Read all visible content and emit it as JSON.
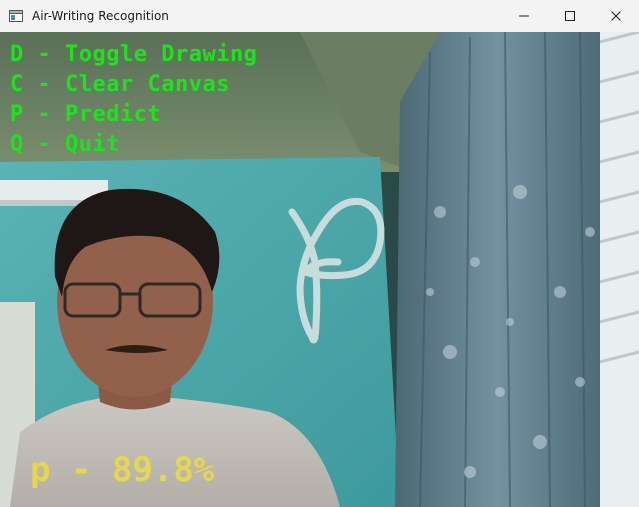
{
  "window": {
    "title": "Air-Writing Recognition",
    "icon": "app-window-icon",
    "controls": [
      "minimize-icon",
      "maximize-icon",
      "close-icon"
    ]
  },
  "overlay": {
    "instructions": [
      {
        "key": "D",
        "sep": " - ",
        "label": "Toggle Drawing"
      },
      {
        "key": "C",
        "sep": " - ",
        "label": "Clear Canvas"
      },
      {
        "key": "P",
        "sep": " - ",
        "label": "Predict"
      },
      {
        "key": "Q",
        "sep": " - ",
        "label": "Quit"
      }
    ],
    "prediction": {
      "letter": "p",
      "sep": " - ",
      "confidence": "89.8%"
    }
  },
  "colors": {
    "instruction_text": "#19e619",
    "prediction_text": "#e6d84a",
    "stroke": "#c8dcdc",
    "wall": "#4aa7a9",
    "curtain": "#5f7e8c"
  }
}
